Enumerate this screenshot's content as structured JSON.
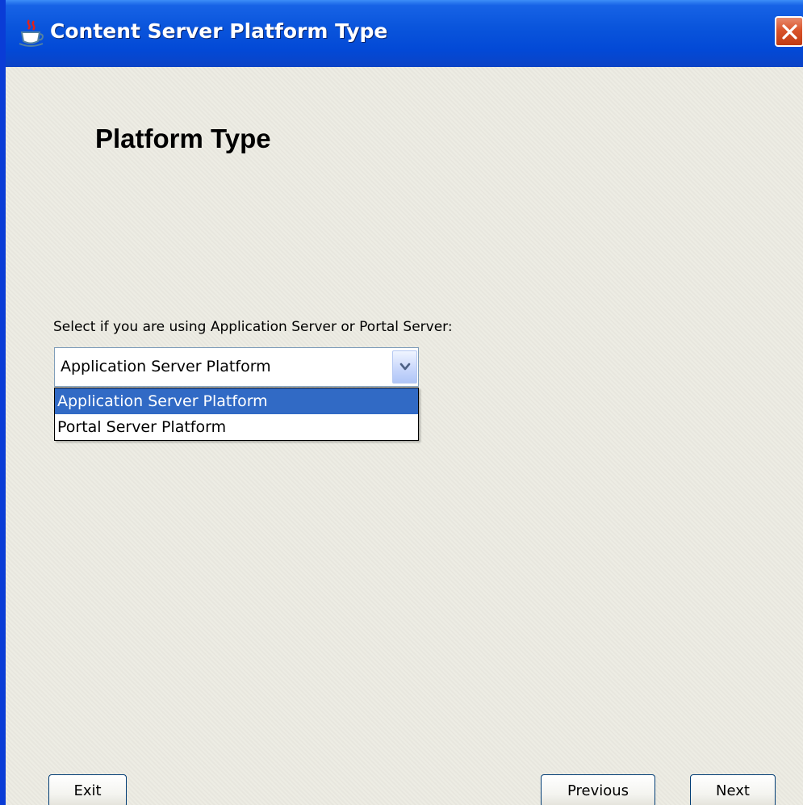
{
  "window": {
    "title": "Content Server Platform Type",
    "title_icon": "java-cup-icon",
    "close_icon": "close-icon",
    "titlebar_color": "#0a55dc",
    "close_color": "#d9542b"
  },
  "main": {
    "heading": "Platform Type",
    "prompt": "Select if you are using Application Server or Portal Server:"
  },
  "platform_select": {
    "selected_value": "Application Server Platform",
    "arrow_icon": "chevron-down-icon",
    "options": [
      {
        "label": "Application Server Platform",
        "highlighted": true
      },
      {
        "label": "Portal Server Platform",
        "highlighted": false
      }
    ],
    "highlight_color": "#316ac5"
  },
  "buttons": {
    "exit": "Exit",
    "previous": "Previous",
    "next": "Next"
  }
}
